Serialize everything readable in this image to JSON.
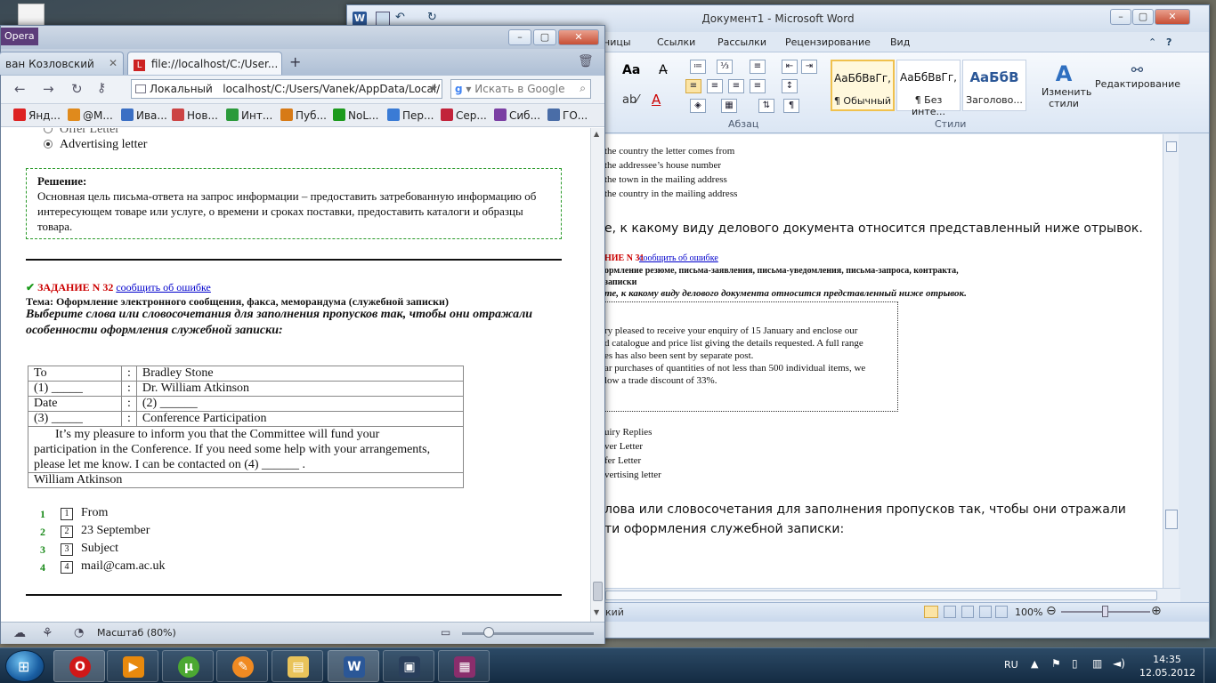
{
  "word": {
    "title": "Документ1 - Microsoft Word",
    "tabs": [
      "ницы",
      "Ссылки",
      "Рассылки",
      "Рецензирование",
      "Вид"
    ],
    "styles": [
      {
        "sample": "АаБбВвГг,",
        "name": "¶ Обычный"
      },
      {
        "sample": "АаБбВвГг,",
        "name": "¶ Без инте..."
      },
      {
        "sample": "АаБбВ",
        "name": "Заголово..."
      }
    ],
    "group_paragraph": "Абзац",
    "group_styles": "Стили",
    "change_styles": "Изменить стили",
    "editing": "Редактирование",
    "font_label": "Aa",
    "zoom": "100%",
    "status_left": "кий",
    "doc_lines": [
      "the country the letter comes from",
      "the addressee’s house number",
      "the town in the mailing address",
      "the country in the mailing address",
      "е, к какому виду делового документа относится представленный ниже отрывок.",
      "НИЕ N 31",
      "сообщить об ошибке",
      "ормление резюме, письма-заявления, письма-уведомления, письма-запроса, контракта,",
      "записки",
      "те, к какому виду делового документа относится представленный ниже отрывок.",
      "ry pleased to receive your enquiry of 15 January and enclose our",
      "d catalogue and price list giving the details requested. A full range",
      "es has also been sent by separate post.",
      "ar purchases of quantities of not less than 500 individual items, we",
      "low a trade discount of 33%.",
      "uiry Replies",
      "ver Letter",
      "fer Letter",
      "vertising letter",
      "лова или словосочетания для заполнения пропусков так, чтобы они отражали",
      "ти оформления служебной записки:"
    ]
  },
  "opera": {
    "label": "Opera",
    "tabs": [
      "ван Козловский",
      "file://localhost/C:/User..."
    ],
    "address": "localhost/C:/Users/Vanek/AppData/Local/",
    "address_prefix": "Локальный",
    "search_placeholder": "Искать в Google",
    "bookmarks": [
      "Янд...",
      "@M...",
      "Ива...",
      "Нов...",
      "Инт...",
      "Пуб...",
      "NoL...",
      "Пер...",
      "Сер...",
      "Сиб...",
      "ГО..."
    ],
    "bookmark_colors": [
      "#d22",
      "#e08a1c",
      "#3b6fc4",
      "#c44",
      "#2b9a3b",
      "#d77a16",
      "#1d9a1d",
      "#3a7bd5",
      "#c2233a",
      "#7b3fa3",
      "#4a6da7"
    ],
    "status_zoom": "Масштаб (80%)",
    "page": {
      "opt_offer": "Offer Letter",
      "opt_advert": "Advertising letter",
      "solution_title": "Решение:",
      "solution_text": "Основная цель письма-ответа на запрос информации – предоставить затребованную информацию об интересующем товаре или услуге, о времени и сроках поставки, предоставить каталоги и образцы товара.",
      "task_label": "ЗАДАНИЕ N 32",
      "report_link": "сообщить об ошибке",
      "topic": "Тема: Оформление электронного сообщения, факса, меморандума (служебной записки)",
      "question_1": "Выберите слова или словосочетания для заполнения пропусков так, чтобы они отражали",
      "question_2": "особенности оформления служебной записки:",
      "memo": [
        [
          "To",
          ":",
          "Bradley Stone"
        ],
        [
          "(1)  _____",
          ":",
          "Dr. William Atkinson"
        ],
        [
          "Date",
          ":",
          "(2) ______"
        ],
        [
          "(3) _____",
          ":",
          "Conference Participation"
        ]
      ],
      "memo_body_1": "It’s my pleasure to inform you that the Committee will fund your",
      "memo_body_2": "participation in the Conference. If you need some help with your arrangements,",
      "memo_body_3": "please let me know. I can be contacted on (4) ______ .",
      "memo_sign": "William Atkinson",
      "answers": [
        {
          "num": "1",
          "box": "1",
          "text": "From"
        },
        {
          "num": "2",
          "box": "2",
          "text": "23  September"
        },
        {
          "num": "3",
          "box": "3",
          "text": "Subject"
        },
        {
          "num": "4",
          "box": "4",
          "text": "mail@cam.ac.uk"
        }
      ]
    }
  },
  "taskbar": {
    "lang": "RU",
    "time": "14:35",
    "date": "12.05.2012"
  }
}
